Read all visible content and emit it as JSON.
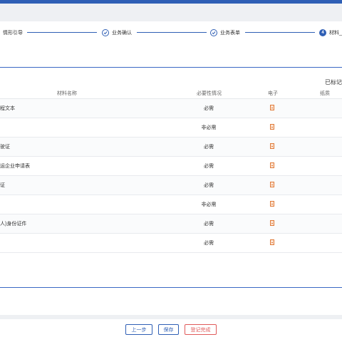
{
  "stepper": {
    "steps": [
      {
        "label": "情形引导",
        "state": "done"
      },
      {
        "label": "业务确认",
        "state": "done"
      },
      {
        "label": "业务表单",
        "state": "done"
      },
      {
        "label": "材料_",
        "number": "4",
        "state": "active"
      }
    ]
  },
  "panel": {
    "marked_label": "已标记"
  },
  "table": {
    "headers": {
      "name": "材料名称",
      "necessity": "必要性情况",
      "electronic": "电子",
      "paper": "纸质"
    },
    "rows": [
      {
        "name": "程文本",
        "necessity": "必需"
      },
      {
        "name": "",
        "necessity": "非必需"
      },
      {
        "name": "驶证",
        "necessity": "必需"
      },
      {
        "name": "运企业申请表",
        "necessity": "必需"
      },
      {
        "name": "证",
        "necessity": "必需"
      },
      {
        "name": "",
        "necessity": "非必需"
      },
      {
        "name": "人)身份证件",
        "necessity": "必需"
      },
      {
        "name": "",
        "necessity": "必需"
      }
    ]
  },
  "buttons": {
    "prev": "上一步",
    "save": "保存",
    "complete": "登记完成"
  },
  "colors": {
    "accent": "#2f5fb5",
    "danger": "#e05a5a",
    "file_icon": "#e07b39"
  }
}
